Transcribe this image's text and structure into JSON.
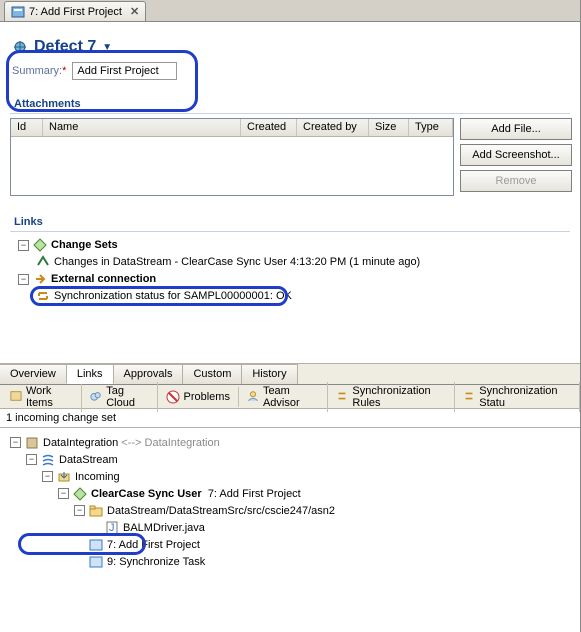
{
  "topTab": {
    "label": "7: Add First Project"
  },
  "defect": {
    "title": "Defect 7"
  },
  "summary": {
    "label": "Summary:",
    "asterisk": "*",
    "value": "Add First Project"
  },
  "attachments": {
    "heading": "Attachments",
    "columns": {
      "id": "Id",
      "name": "Name",
      "created": "Created",
      "createdBy": "Created by",
      "size": "Size",
      "type": "Type"
    },
    "buttons": {
      "addFile": "Add File...",
      "addScreenshot": "Add Screenshot...",
      "remove": "Remove"
    }
  },
  "links": {
    "heading": "Links",
    "changeSets": "Change Sets",
    "csItem": "Changes in DataStream - ClearCase Sync User 4:13:20 PM (1 minute ago)",
    "external": "External connection",
    "extItem": "Synchronization status for SAMPL00000001: OK"
  },
  "pageTabs": [
    "Overview",
    "Links",
    "Approvals",
    "Custom",
    "History"
  ],
  "viewTabs": [
    "Work Items",
    "Tag Cloud",
    "Problems",
    "Team Advisor",
    "Synchronization Rules",
    "Synchronization Statu"
  ],
  "status": "1 incoming change set",
  "tree": {
    "n0": "DataIntegration",
    "n0g": "<--> DataIntegration",
    "n1": "DataStream",
    "n2": "Incoming",
    "n3a": "ClearCase Sync User",
    "n3b": "7: Add First Project",
    "n4": "DataStream/DataStreamSrc/src/cscie247/asn2",
    "n5": "BALMDriver.java",
    "n6": "7: Add First Project",
    "n7": "9: Synchronize Task"
  }
}
